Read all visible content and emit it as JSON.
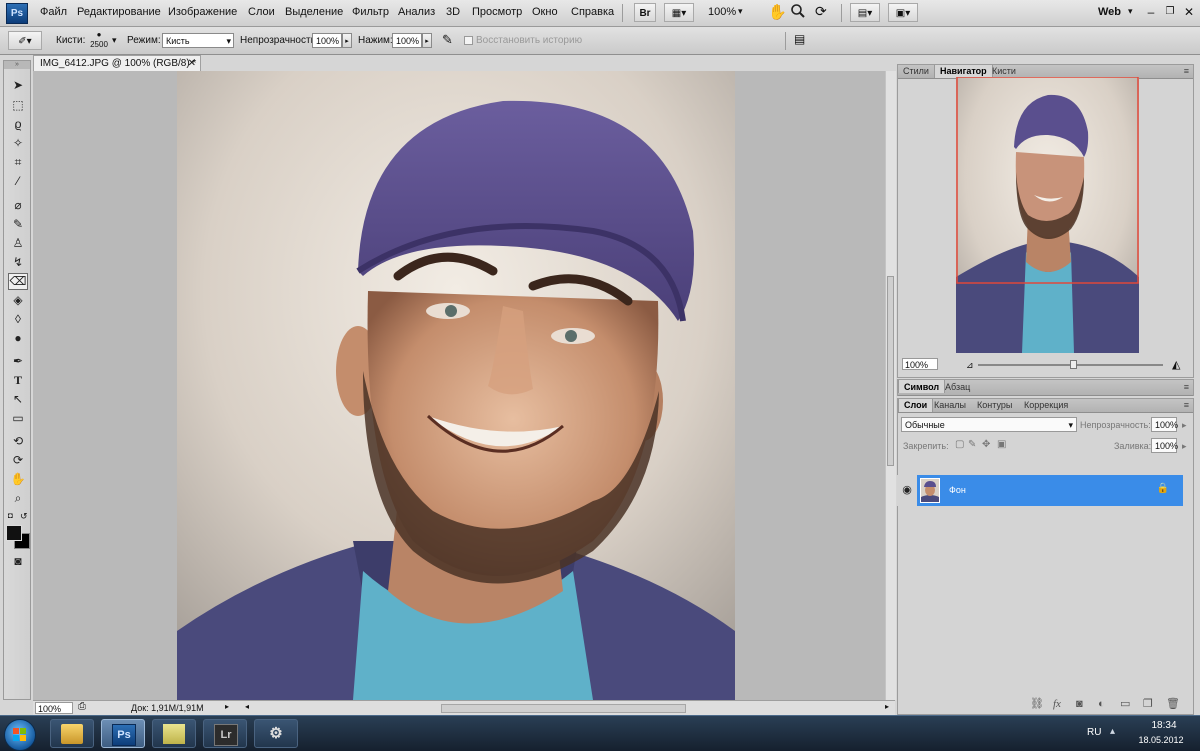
{
  "app": {
    "logo": "Ps"
  },
  "menu": [
    "Файл",
    "Редактирование",
    "Изображение",
    "Слои",
    "Выделение",
    "Фильтр",
    "Анализ",
    "3D",
    "Просмотр",
    "Окно",
    "Справка"
  ],
  "menubar": {
    "bridge": "Br",
    "zoom": "100%",
    "workspace": "Web"
  },
  "options": {
    "brush_label": "Кисти:",
    "brush_size": "2500",
    "mode_label": "Режим:",
    "mode_value": "Кисть",
    "opacity_label": "Непрозрачность:",
    "opacity_value": "100%",
    "pressure_label": "Нажим:",
    "pressure_value": "100%",
    "restore_history": "Восстановить историю"
  },
  "document": {
    "tab_title": "IMG_6412.JPG @ 100% (RGB/8) *",
    "zoom": "100%",
    "doc_info": "Док: 1,91M/1,91M"
  },
  "panels": {
    "top_tabs": [
      "Стили",
      "Навигатор",
      "Кисти"
    ],
    "top_active": 1,
    "navigator_zoom": "100%",
    "mid_tabs": [
      "Символ",
      "Абзац"
    ],
    "mid_active": 0,
    "layer_tabs": [
      "Слои",
      "Каналы",
      "Контуры",
      "Коррекция"
    ],
    "layer_active": 0
  },
  "layers": {
    "blend_mode": "Обычные",
    "opacity_label": "Непрозрачность:",
    "opacity_value": "100%",
    "lock_label": "Закрепить:",
    "fill_label": "Заливка:",
    "fill_value": "100%",
    "items": [
      {
        "name": "Фон",
        "visible": true,
        "locked": true,
        "selected": true
      }
    ]
  },
  "taskbar": {
    "apps": [
      "Windows Explorer",
      "Photoshop",
      "Sticky Notes",
      "Lightroom",
      "Camera Tool"
    ],
    "active_app": "Photoshop",
    "lr_label": "Lr",
    "ps_label": "Ps",
    "language": "RU",
    "time": "18:34",
    "date": "18.05.2012"
  },
  "colors": {
    "selection_blue": "#3a8ce8",
    "navigator_frame": "#e0483a",
    "cap_purple": "#5a4f8e",
    "shirt_teal": "#5fb1c9"
  }
}
